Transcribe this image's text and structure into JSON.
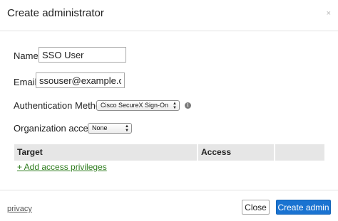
{
  "dialog": {
    "title": "Create administrator",
    "close_glyph": "×"
  },
  "form": {
    "name": {
      "label": "Name:",
      "value": "SSO User"
    },
    "email": {
      "label": "Email:",
      "value": "ssouser@example.com"
    },
    "auth_method": {
      "label": "Authentication Method:",
      "selected": "Cisco SecureX Sign-On",
      "info_icon": "info-icon"
    },
    "org_access": {
      "label": "Organization access:",
      "selected": "None"
    }
  },
  "privileges_table": {
    "columns": [
      "Target",
      "Access",
      ""
    ],
    "add_link": "+ Add access privileges"
  },
  "footer": {
    "privacy": "privacy",
    "close_label": "Close",
    "create_label": "Create admin"
  },
  "colors": {
    "primary_button": "#1a73d1",
    "link_green": "#2f7d1f",
    "table_header_bg": "#e6e6e6"
  }
}
